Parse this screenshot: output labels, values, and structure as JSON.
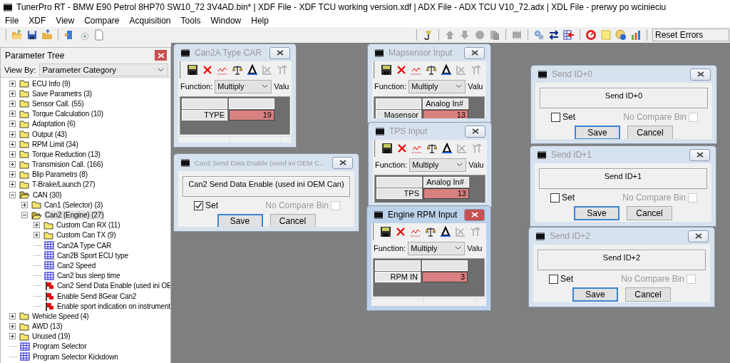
{
  "window": {
    "title": "TunerPro RT - BMW E90 Petrol 8HP70 SW10_72 3V4AD.bin* | XDF File - XDF TCU working version.xdf | ADX File - ADX TCU V10_72.adx | XDL File - prerwy po wcinieciu"
  },
  "menu": [
    "File",
    "XDF",
    "View",
    "Compare",
    "Acquisition",
    "Tools",
    "Window",
    "Help"
  ],
  "toolbar": {
    "reset_errors": "Reset Errors"
  },
  "parameter_tree": {
    "title": "Parameter Tree",
    "view_by_label": "View By:",
    "view_by": "Parameter Category",
    "items": [
      {
        "label": "ECU Info (9)",
        "kind": "folder",
        "expanded": false,
        "selected": false
      },
      {
        "label": "Save Parametrs (3)",
        "kind": "folder",
        "expanded": false,
        "selected": false
      },
      {
        "label": "Sensor Call. (55)",
        "kind": "folder",
        "expanded": false,
        "selected": false
      },
      {
        "label": "Torque Calculation (10)",
        "kind": "folder",
        "expanded": false,
        "selected": false
      },
      {
        "label": "Adaptation (6)",
        "kind": "folder",
        "expanded": false,
        "selected": false
      },
      {
        "label": "Output (43)",
        "kind": "folder",
        "expanded": false,
        "selected": false
      },
      {
        "label": "RPM Limit (34)",
        "kind": "folder",
        "expanded": false,
        "selected": false
      },
      {
        "label": "Torque Reduction (13)",
        "kind": "folder",
        "expanded": false,
        "selected": false
      },
      {
        "label": "Transmision Call. (166)",
        "kind": "folder",
        "expanded": false,
        "selected": false
      },
      {
        "label": "Blip Parametrs (8)",
        "kind": "folder",
        "expanded": false,
        "selected": false
      },
      {
        "label": "T-Brake/Launch (27)",
        "kind": "folder",
        "expanded": false,
        "selected": false
      },
      {
        "label": "CAN (30)",
        "kind": "folder",
        "expanded": true,
        "selected": false,
        "children": [
          {
            "label": "Can1 (Selector) (3)",
            "kind": "folder",
            "expanded": false,
            "selected": false
          },
          {
            "label": "Can2 (Engine) (27)",
            "kind": "folder",
            "expanded": true,
            "selected": true,
            "children": [
              {
                "label": "Custom Can RX (11)",
                "kind": "folder",
                "expanded": false,
                "selected": false
              },
              {
                "label": "Custom Can TX (9)",
                "kind": "folder",
                "expanded": false,
                "selected": false
              },
              {
                "label": "Can2A Type CAR",
                "kind": "table",
                "selected": false
              },
              {
                "label": "Can2B Sport ECU type",
                "kind": "table",
                "selected": false
              },
              {
                "label": "Can2 Speed",
                "kind": "table",
                "selected": false
              },
              {
                "label": "Can2 bus sleep time",
                "kind": "table",
                "selected": false
              },
              {
                "label": "Can2 Send Data Enable (used ini OE",
                "kind": "flag",
                "selected": false
              },
              {
                "label": "Enable Send 8Gear Can2",
                "kind": "flag",
                "selected": false
              },
              {
                "label": "Enable sport indication on instrument",
                "kind": "flag",
                "selected": false
              }
            ]
          }
        ]
      },
      {
        "label": "Wehicle Speed (4)",
        "kind": "folder",
        "expanded": false,
        "selected": false
      },
      {
        "label": "AWD (13)",
        "kind": "folder",
        "expanded": false,
        "selected": false
      },
      {
        "label": "Unused (19)",
        "kind": "folder",
        "expanded": false,
        "selected": false
      },
      {
        "label": "Program Selector",
        "kind": "table",
        "selected": false
      },
      {
        "label": "Program Selector Kickdown",
        "kind": "table",
        "selected": false
      }
    ]
  },
  "child_windows": [
    {
      "kind": "table",
      "title": "Can2A Type CAR",
      "active": false,
      "function_label": "Function:",
      "function": "Multiply",
      "value_label": "Valu",
      "row_label": "TYPE",
      "value": "19"
    },
    {
      "kind": "flag",
      "title": "Can2 Send Data Enable (used ini OEM C...",
      "active": false,
      "description": "Can2 Send Data Enable (used ini OEM Can)",
      "set_label": "Set",
      "checked": true,
      "no_compare_label": "No Compare Bin",
      "no_compare_checked": false,
      "save": "Save",
      "cancel": "Cancel"
    },
    {
      "kind": "table",
      "title": "Mapsensor Input",
      "active": false,
      "function_label": "Function:",
      "function": "Multiply",
      "value_label": "Valu",
      "column_header": "Analog In#",
      "row_label": "Masensor",
      "value": "13"
    },
    {
      "kind": "table",
      "title": "TPS Input",
      "active": false,
      "function_label": "Function:",
      "function": "Multiply",
      "value_label": "Valu",
      "column_header": "Analog In#",
      "row_label": "TPS",
      "value": "13"
    },
    {
      "kind": "table",
      "title": "Engine RPM Input",
      "active": true,
      "function_label": "Function:",
      "function": "Multiply",
      "value_label": "Valu",
      "row_label": "RPM IN",
      "value": "3"
    },
    {
      "kind": "flag",
      "title": "Send ID+0",
      "active": false,
      "description": "Send ID+0",
      "set_label": "Set",
      "checked": false,
      "no_compare_label": "No Compare Bin",
      "no_compare_checked": false,
      "save": "Save",
      "cancel": "Cancel"
    },
    {
      "kind": "flag",
      "title": "Send ID+1",
      "active": false,
      "description": "Send ID+1",
      "set_label": "Set",
      "checked": false,
      "no_compare_label": "No Compare Bin",
      "no_compare_checked": false,
      "save": "Save",
      "cancel": "Cancel"
    },
    {
      "kind": "flag",
      "title": "Send ID+2",
      "active": false,
      "description": "Send ID+2",
      "set_label": "Set",
      "checked": false,
      "no_compare_label": "No Compare Bin",
      "no_compare_checked": false,
      "save": "Save",
      "cancel": "Cancel"
    }
  ]
}
